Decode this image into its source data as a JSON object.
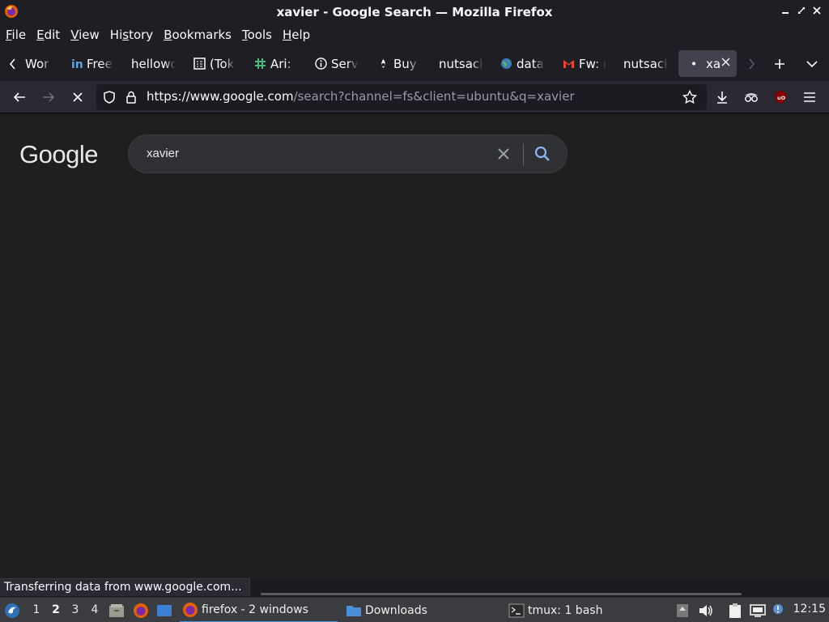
{
  "window": {
    "title": "xavier - Google Search — Mozilla Firefox",
    "controls": {
      "minimize": "minimize-icon",
      "restore": "restore-icon",
      "close": "close-icon"
    }
  },
  "menu": {
    "items": [
      {
        "pre": "",
        "key": "F",
        "post": "ile"
      },
      {
        "pre": "",
        "key": "E",
        "post": "dit"
      },
      {
        "pre": "",
        "key": "V",
        "post": "iew"
      },
      {
        "pre": "Hi",
        "key": "s",
        "post": "tory"
      },
      {
        "pre": "",
        "key": "B",
        "post": "ookmarks"
      },
      {
        "pre": "",
        "key": "T",
        "post": "ools"
      },
      {
        "pre": "",
        "key": "H",
        "post": "elp"
      }
    ]
  },
  "tabs": [
    {
      "label": "Wor",
      "icon": "none"
    },
    {
      "label": "Free",
      "icon": "linkedin-icon"
    },
    {
      "label": "hellowo",
      "icon": "none"
    },
    {
      "label": "(Tok",
      "icon": "calendar-icon"
    },
    {
      "label": "Ari:",
      "icon": "slack-icon"
    },
    {
      "label": "Serv",
      "icon": "info-icon"
    },
    {
      "label": "Buy",
      "icon": "drop-icon"
    },
    {
      "label": "nutsack",
      "icon": "none"
    },
    {
      "label": "data",
      "icon": "globe-icon"
    },
    {
      "label": "Fw: r",
      "icon": "gmail-icon"
    },
    {
      "label": "nutsack",
      "icon": "none"
    },
    {
      "label": "xa",
      "icon": "loading-dot-icon",
      "active": true
    }
  ],
  "nav": {
    "url_host": "https://www.google.com",
    "url_path": "/search?channel=fs&client=ubuntu&q=xavier"
  },
  "google": {
    "logo": "Google",
    "query": "xavier"
  },
  "status": {
    "text": "Transferring data from www.google.com..."
  },
  "taskbar": {
    "workspaces": [
      "1",
      "2",
      "3",
      "4"
    ],
    "current_workspace": "2",
    "tasks": [
      {
        "label": "firefox - 2 windows",
        "active": true
      },
      {
        "label": "Downloads",
        "active": false
      },
      {
        "label": "tmux: 1 bash",
        "active": false
      }
    ],
    "clock": "12:15"
  },
  "colors": {
    "chrome": "#1f1e25",
    "navbar": "#2b2a33",
    "urlbar": "#1c1b22",
    "page": "#1f1f1f",
    "search_box": "#303134",
    "taskbar": "#3a3c3f",
    "google_blue": "#8ab4f8"
  }
}
